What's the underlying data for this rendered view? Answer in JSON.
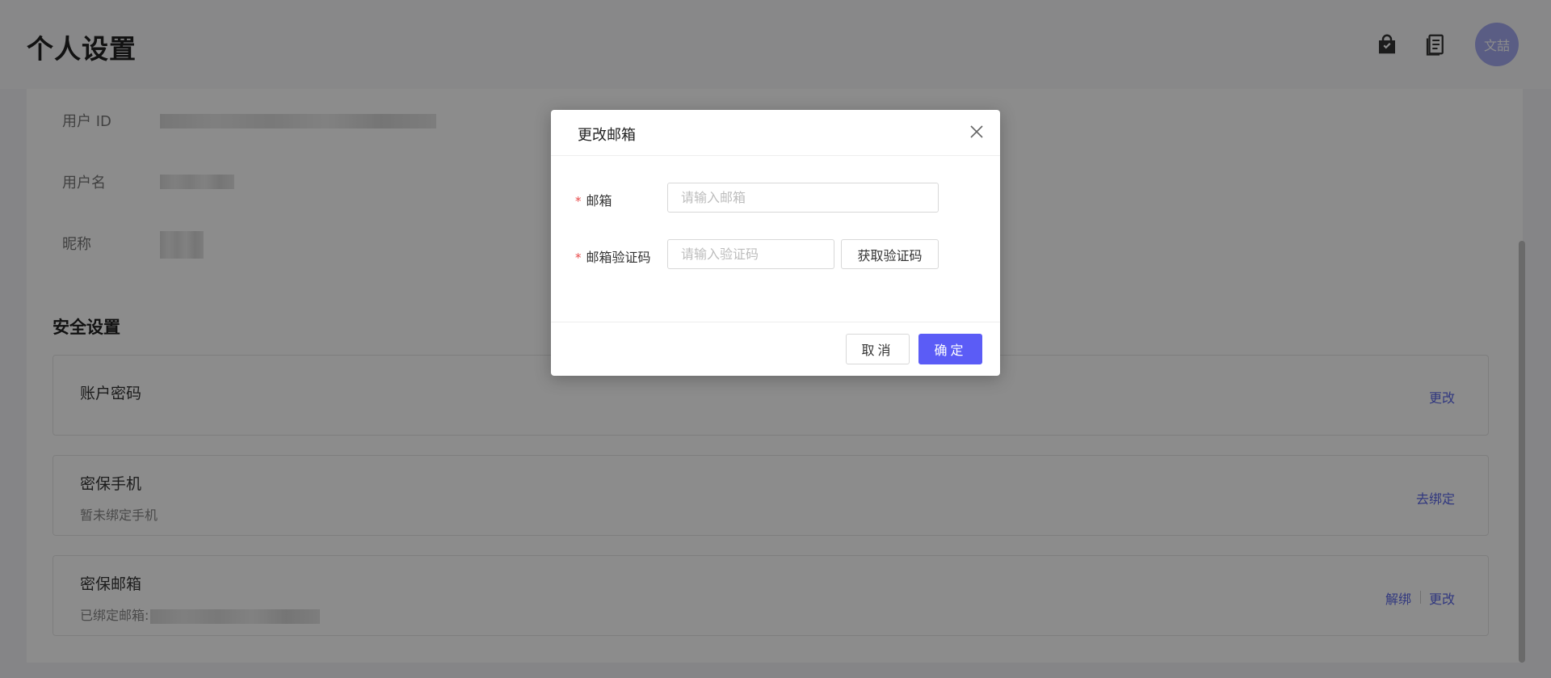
{
  "header": {
    "title": "个人设置",
    "avatar_text": "文喆"
  },
  "profile": {
    "user_id_label": "用户 ID",
    "username_label": "用户名",
    "nickname_label": "昵称"
  },
  "security": {
    "section_title": "安全设置",
    "password": {
      "title": "账户密码",
      "link": "更改"
    },
    "phone": {
      "title": "密保手机",
      "desc": "暂未绑定手机",
      "link": "去绑定"
    },
    "email": {
      "title": "密保邮箱",
      "desc": "已绑定邮箱:",
      "unbind_link": "解绑",
      "change_link": "更改"
    }
  },
  "modal": {
    "title": "更改邮箱",
    "required_mark": "*",
    "email_label": "邮箱",
    "email_placeholder": "请输入邮箱",
    "code_label": "邮箱验证码",
    "code_placeholder": "请输入验证码",
    "get_code_button": "获取验证码",
    "cancel_button": "取消",
    "confirm_button": "确定"
  },
  "colors": {
    "accent": "#5b5cf6",
    "link": "#5a66e8",
    "required": "#e84a4a"
  },
  "icons": [
    "bag-icon",
    "document-icon",
    "close-icon"
  ]
}
